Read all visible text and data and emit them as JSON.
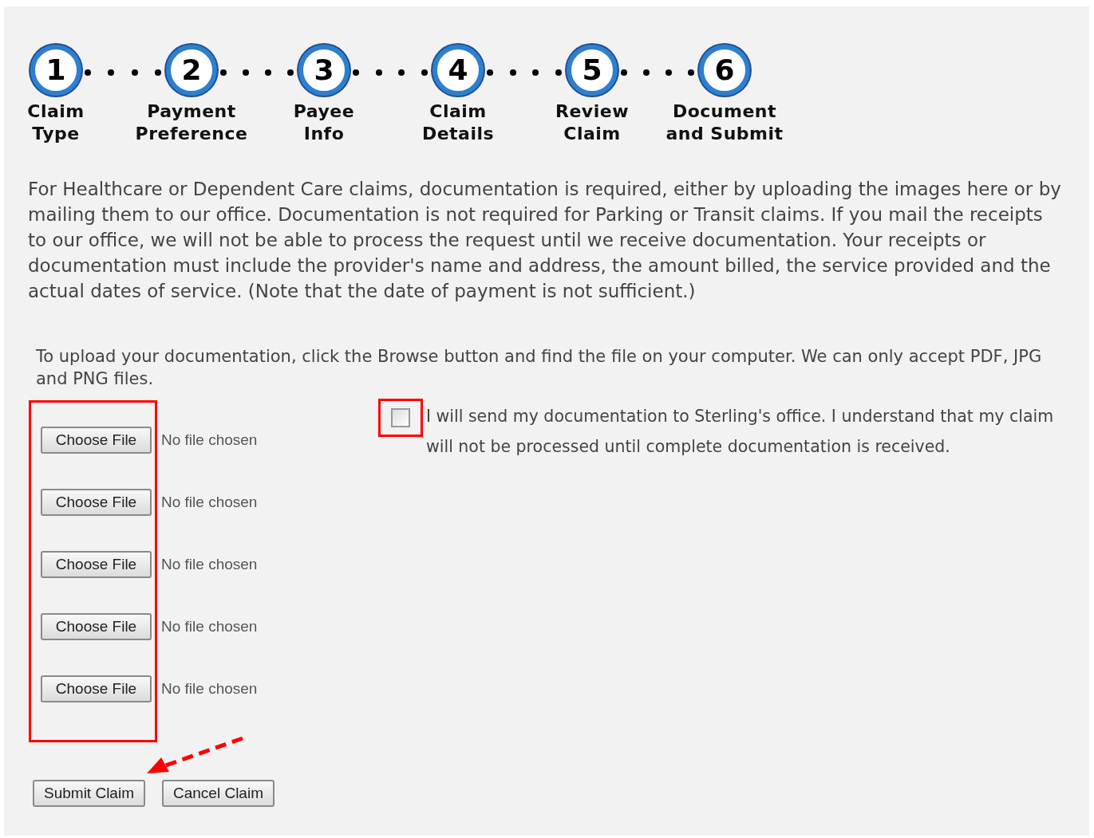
{
  "steps": [
    {
      "number": "1",
      "label": [
        "Claim",
        "Type"
      ]
    },
    {
      "number": "2",
      "label": [
        "Payment",
        "Preference"
      ]
    },
    {
      "number": "3",
      "label": [
        "Payee",
        "Info"
      ]
    },
    {
      "number": "4",
      "label": [
        "Claim",
        "Details"
      ]
    },
    {
      "number": "5",
      "label": [
        "Review",
        "Claim"
      ]
    },
    {
      "number": "6",
      "label": [
        "Document",
        "and Submit"
      ]
    }
  ],
  "intro": "For Healthcare or Dependent Care claims, documentation is required, either by uploading the images here or by mailing them to our office. Documentation is not required for Parking or Transit claims. If you mail the receipts to our office, we will not be able to process the request until we receive documentation. Your receipts or documentation must include the provider's name and address, the amount billed, the service provided and the actual dates of service. (Note that the date of payment is not sufficient.)",
  "upload_hint": "To upload your documentation, click the Browse button and find the file on your computer. We can only accept PDF, JPG and PNG files.",
  "file_inputs": [
    {
      "button": "Choose File",
      "status": "No file chosen"
    },
    {
      "button": "Choose File",
      "status": "No file chosen"
    },
    {
      "button": "Choose File",
      "status": "No file chosen"
    },
    {
      "button": "Choose File",
      "status": "No file chosen"
    },
    {
      "button": "Choose File",
      "status": "No file chosen"
    }
  ],
  "mail_option": {
    "checked": false,
    "label": "I will send my documentation to Sterling's office. I understand that my claim will not be processed until complete documentation is received."
  },
  "buttons": [
    "Submit Claim",
    "Cancel Claim"
  ]
}
